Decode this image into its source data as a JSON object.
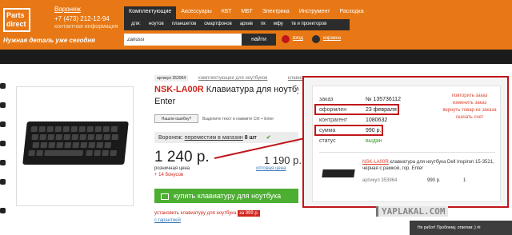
{
  "header": {
    "logo_line1": "Parts",
    "logo_line2": "direct",
    "city": "Воронеж",
    "phone": "+7 (473) 212-12-94",
    "contact": "контактная информация",
    "slogan": "Нужная деталь уже сегодня",
    "category_tabs": [
      "Комплектующие",
      "Аксессуары",
      "КБТ",
      "МБТ",
      "Электрика",
      "Инструмент",
      "Расходка"
    ],
    "sub_items": [
      "для:",
      "ноутов",
      "планшетов",
      "смартфонов",
      "архив",
      "пк",
      "мфу",
      "тв и проекторов"
    ],
    "search_value": "Zanussi",
    "search_button": "найти",
    "login": "вход",
    "cart_label": "корзина"
  },
  "product": {
    "article": "артикул 353964",
    "breadcrumb": [
      "комплектующие для ноутбуков",
      "клавиатуры"
    ],
    "title_code": "NSK-LA00R",
    "title_rest": "Клавиатура для ноутбука",
    "title_line2": "Enter",
    "mistake_button": "Нашли ошибку?",
    "mistake_hint": "Выделите текст и нажмите Ctrl + Enter",
    "stock_city": "Воронеж:",
    "stock_link": "переместим в магазин",
    "stock_count": "8 шт",
    "price": "1 240 р.",
    "retail_label": "розничная цена",
    "bonus": "+ 14 бонусов",
    "wholesale_price": "1 190 р.",
    "wholesale_label": "оптовая цена",
    "buy_button": "купить клавиатуру для ноутбука",
    "install_text": "установить клавиатуру для ноутбука",
    "install_price": "за 999 р.",
    "warranty": "с гарантией"
  },
  "order": {
    "fields": [
      {
        "label": "заказ",
        "value": "№ 135736112"
      },
      {
        "label": "оформлен",
        "value": "23 февраля"
      },
      {
        "label": "контрагент",
        "value": "1080632"
      },
      {
        "label": "сумма",
        "value": "990 р."
      },
      {
        "label": "статус",
        "value": "выдан"
      }
    ],
    "links": [
      "повторить заказ",
      "изменить заказ",
      "вернуть товар из заказа",
      "скачать счет"
    ],
    "item_code": "NSK-LA00R",
    "item_desc": "клавиатура для ноутбука Dell Inspiron 15-3521, черная с рамкой, гор. Enter",
    "item_article": "артикул 353964",
    "item_price": "990 р.",
    "item_qty": "1"
  },
  "footer": {
    "watermark": "YAPLAKAL.COM",
    "strip_text": "Не работ! Проблему, ответим ;) ✉"
  },
  "colors": {
    "header_orange": "#e87815",
    "highlight_red": "#c0151b",
    "buy_green": "#4caf32"
  }
}
